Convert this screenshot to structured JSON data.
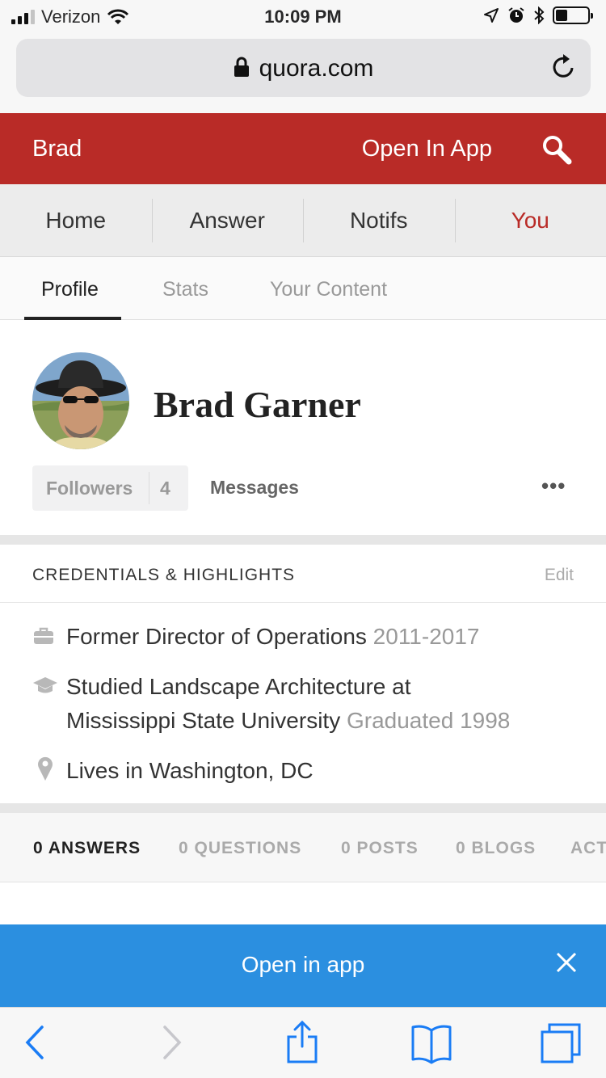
{
  "status_bar": {
    "carrier": "Verizon",
    "time": "10:09 PM",
    "icons": [
      "signal-icon",
      "wifi-icon",
      "location-icon",
      "alarm-icon",
      "bluetooth-icon",
      "battery-icon"
    ],
    "battery_level": 0.38
  },
  "browser": {
    "url": "quora.com",
    "icons": [
      "lock-icon",
      "reload-icon"
    ]
  },
  "header": {
    "brand": "Brad",
    "open_in_app": "Open In App",
    "accent_color": "#b92b27"
  },
  "nav": {
    "items": [
      {
        "label": "Home"
      },
      {
        "label": "Answer"
      },
      {
        "label": "Notifs"
      },
      {
        "label": "You"
      }
    ],
    "active": "You"
  },
  "subtabs": {
    "items": [
      {
        "label": "Profile"
      },
      {
        "label": "Stats"
      },
      {
        "label": "Your Content"
      }
    ],
    "active": "Profile"
  },
  "profile": {
    "name": "Brad Garner",
    "followers_label": "Followers",
    "followers_count": "4",
    "messages_label": "Messages",
    "more_label": "•••"
  },
  "credentials": {
    "title": "CREDENTIALS & HIGHLIGHTS",
    "edit_label": "Edit",
    "items": [
      {
        "icon": "briefcase-icon",
        "text": "Former Director of Operations",
        "detail": "2011-2017"
      },
      {
        "icon": "graduation-cap-icon",
        "text_line1": "Studied Landscape Architecture at",
        "text_line2": "Mississippi State University",
        "detail": "Graduated 1998"
      },
      {
        "icon": "location-pin-icon",
        "text": "Lives in Washington, DC"
      }
    ]
  },
  "content_tabs": {
    "items": [
      {
        "label": "0 ANSWERS"
      },
      {
        "label": "0 QUESTIONS"
      },
      {
        "label": "0 POSTS"
      },
      {
        "label": "0 BLOGS"
      },
      {
        "label": "ACT"
      }
    ],
    "active": "0 ANSWERS"
  },
  "banner": {
    "text": "Open in app",
    "color": "#2b8fe0"
  },
  "toolbar": {
    "icons": [
      "back-icon",
      "forward-icon",
      "share-icon",
      "bookmarks-icon",
      "tabs-icon"
    ]
  }
}
